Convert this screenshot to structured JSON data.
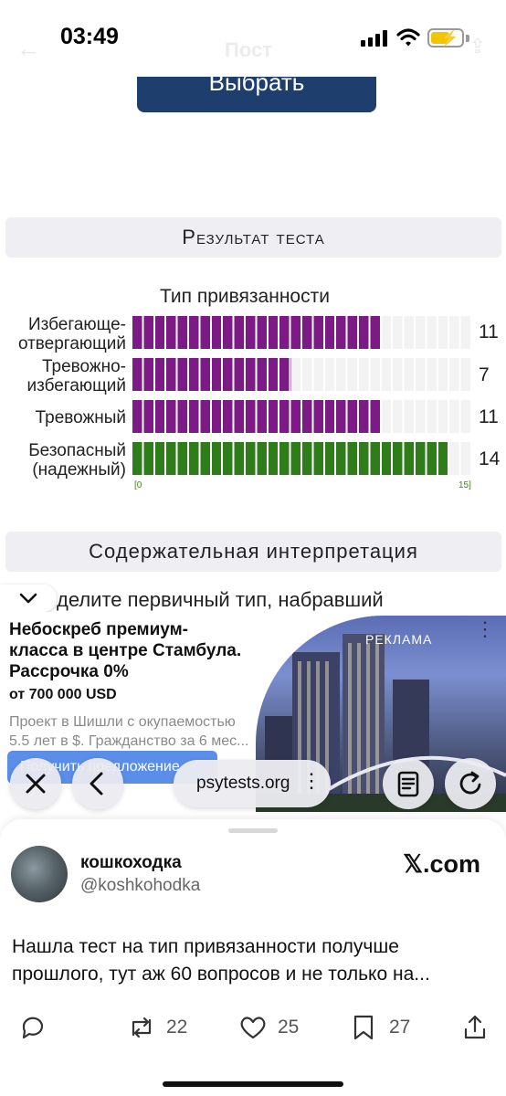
{
  "status_bar": {
    "time": "03:49",
    "ghost_back": "←",
    "ghost_title": "Пост",
    "ghost_share": "⇪"
  },
  "choose_button": {
    "label": "Выбрать"
  },
  "result_section": {
    "title": "Результат теста"
  },
  "chart_data": {
    "type": "bar",
    "orientation": "horizontal",
    "title": "Тип привязанности",
    "categories": [
      "Избегающе-отвергающий",
      "Тревожно-избегающий",
      "Тревожный",
      "Безопасный (надежный)"
    ],
    "values": [
      11,
      7,
      11,
      14
    ],
    "value_labels": [
      "11",
      "7",
      "11",
      "14"
    ],
    "xlim": [
      0,
      15
    ],
    "tick_labels": [
      "[0",
      "15]"
    ],
    "colors": [
      "#7c1a86",
      "#7c1a86",
      "#7c1a86",
      "#2f7d1a"
    ]
  },
  "chart_labels": {
    "row1a": "Избегающе-",
    "row1b": "отвергающий",
    "row2a": "Тревожно-",
    "row2b": "избегающий",
    "row3": "Тревожный",
    "row4a": "Безопасный",
    "row4b": "(надежный)"
  },
  "interpretation_section": {
    "title": "Содержательная интерпретация"
  },
  "article": {
    "text_fragment": "делите первичный тип, набравший"
  },
  "ad": {
    "title": "Небоскреб премиум-класса в центре Стамбула. Рассрочка 0%",
    "price": "от 700 000 USD",
    "description": "Проект в Шишли с окупаемостью 5.5 лет в $. Гражданство за 6 мес...",
    "label": "РЕКЛАМА",
    "cta": "Получить предложение"
  },
  "browser": {
    "url": "psytests.org"
  },
  "tweet": {
    "author_name": "кошкоходка",
    "author_handle": "@koshkohodka",
    "source": "𝕏.com",
    "text": "Нашла тест на тип привязанности получше прошлого, тут аж 60 вопросов и не только на...",
    "retweets": "22",
    "likes": "25",
    "bookmarks": "27"
  },
  "icons": [
    "chevron-down-icon",
    "close-icon",
    "back-icon",
    "more-icon",
    "reader-icon",
    "reload-icon",
    "reply-icon",
    "retweet-icon",
    "like-icon",
    "bookmark-icon",
    "share-icon"
  ]
}
